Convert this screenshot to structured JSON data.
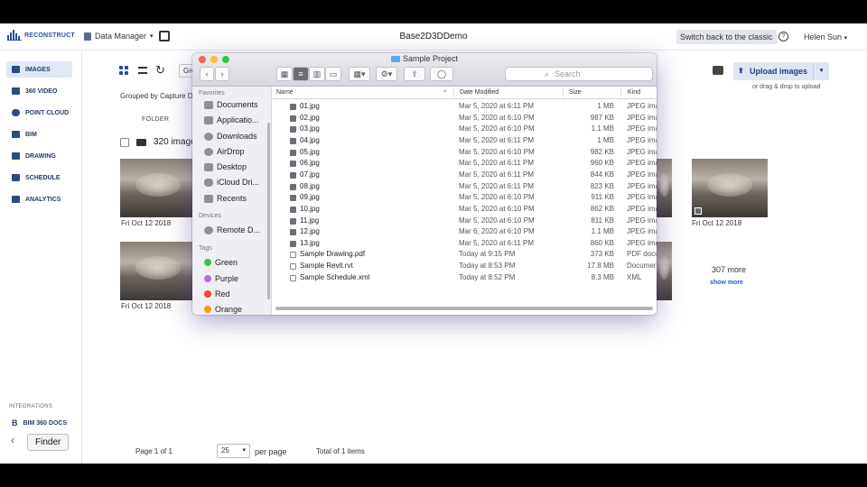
{
  "app": {
    "logo_text": "RECONSTRUCT",
    "data_manager": "Data Manager",
    "project_title": "Base2D3DDemo",
    "classic_button": "Switch back to the classic",
    "help": "?",
    "user": "Helen Sun"
  },
  "sidebar": {
    "items": [
      {
        "label": "IMAGES",
        "icon": "images-icon"
      },
      {
        "label": "360 VIDEO",
        "icon": "video-icon"
      },
      {
        "label": "POINT CLOUD",
        "icon": "cloud-icon"
      },
      {
        "label": "BIM",
        "icon": "bim-icon"
      },
      {
        "label": "DRAWING",
        "icon": "drawing-icon"
      },
      {
        "label": "SCHEDULE",
        "icon": "schedule-icon"
      },
      {
        "label": "ANALYTICS",
        "icon": "analytics-icon"
      }
    ],
    "integrations_label": "INTEGRATIONS",
    "bim360_label": "BIM 360 DOCS",
    "finder_tooltip": "Finder"
  },
  "main": {
    "grouped_by": "Grouped by Capture D",
    "group_select": "Gro",
    "folder_header": "FOLDER",
    "folder_name": "320 images",
    "thumb_dates": [
      "Fri Oct 12 2018",
      "Fri Oct 12 2018",
      "Fri Oct 12 2018"
    ],
    "upload_button": "Upload images",
    "drag_hint": "or drag & drop to upload",
    "more_count": "307 more",
    "show_more": "show more",
    "pagination": {
      "page": "Page 1 of 1",
      "per_page_value": "25",
      "per_page_label": "per page",
      "total": "Total of 1 items"
    }
  },
  "finder": {
    "title": "Sample Project",
    "search_placeholder": "Search",
    "sidebar": {
      "favorites_label": "Favorites",
      "favorites": [
        "Documents",
        "Applicatio...",
        "Downloads",
        "AirDrop",
        "Desktop",
        "iCloud Dri...",
        "Recents"
      ],
      "devices_label": "Devices",
      "devices": [
        "Remote D..."
      ],
      "tags_label": "Tags",
      "tags": [
        {
          "name": "Green",
          "color": "#3cc14a"
        },
        {
          "name": "Purple",
          "color": "#b06ee0"
        },
        {
          "name": "Red",
          "color": "#f0443a"
        },
        {
          "name": "Orange",
          "color": "#f7962a"
        }
      ]
    },
    "columns": [
      "Name",
      "Date Modified",
      "Size",
      "Kind"
    ],
    "files": [
      {
        "name": "01.jpg",
        "date": "Mar 5, 2020 at 6:11 PM",
        "size": "1 MB",
        "kind": "JPEG ima"
      },
      {
        "name": "02.jpg",
        "date": "Mar 5, 2020 at 6:10 PM",
        "size": "987 KB",
        "kind": "JPEG ima"
      },
      {
        "name": "03.jpg",
        "date": "Mar 5, 2020 at 6:10 PM",
        "size": "1.1 MB",
        "kind": "JPEG ima"
      },
      {
        "name": "04.jpg",
        "date": "Mar 5, 2020 at 6:11 PM",
        "size": "1 MB",
        "kind": "JPEG ima"
      },
      {
        "name": "05.jpg",
        "date": "Mar 5, 2020 at 6:10 PM",
        "size": "982 KB",
        "kind": "JPEG ima"
      },
      {
        "name": "06.jpg",
        "date": "Mar 5, 2020 at 6:11 PM",
        "size": "960 KB",
        "kind": "JPEG ima"
      },
      {
        "name": "07.jpg",
        "date": "Mar 5, 2020 at 6:11 PM",
        "size": "844 KB",
        "kind": "JPEG ima"
      },
      {
        "name": "08.jpg",
        "date": "Mar 5, 2020 at 6:11 PM",
        "size": "823 KB",
        "kind": "JPEG ima"
      },
      {
        "name": "09.jpg",
        "date": "Mar 5, 2020 at 6:10 PM",
        "size": "911 KB",
        "kind": "JPEG ima"
      },
      {
        "name": "10.jpg",
        "date": "Mar 5, 2020 at 6:10 PM",
        "size": "862 KB",
        "kind": "JPEG ima"
      },
      {
        "name": "11.jpg",
        "date": "Mar 5, 2020 at 6:10 PM",
        "size": "811 KB",
        "kind": "JPEG ima"
      },
      {
        "name": "12.jpg",
        "date": "Mar 6, 2020 at 6:10 PM",
        "size": "1.1 MB",
        "kind": "JPEG ima"
      },
      {
        "name": "13.jpg",
        "date": "Mar 5, 2020 at 6:11 PM",
        "size": "860 KB",
        "kind": "JPEG ima"
      },
      {
        "name": "Sample Drawing.pdf",
        "date": "Today at 9:15 PM",
        "size": "373 KB",
        "kind": "PDF docu"
      },
      {
        "name": "Sample Revit.rvt",
        "date": "Today at 8:53 PM",
        "size": "17.8 MB",
        "kind": "Documen"
      },
      {
        "name": "Sample Schedule.xml",
        "date": "Today at 8:52 PM",
        "size": "8.3 MB",
        "kind": "XML"
      }
    ]
  },
  "colors": {
    "accent": "#1f4aa8",
    "active_nav": "#dfe8f7",
    "link": "#2a5bd6"
  }
}
